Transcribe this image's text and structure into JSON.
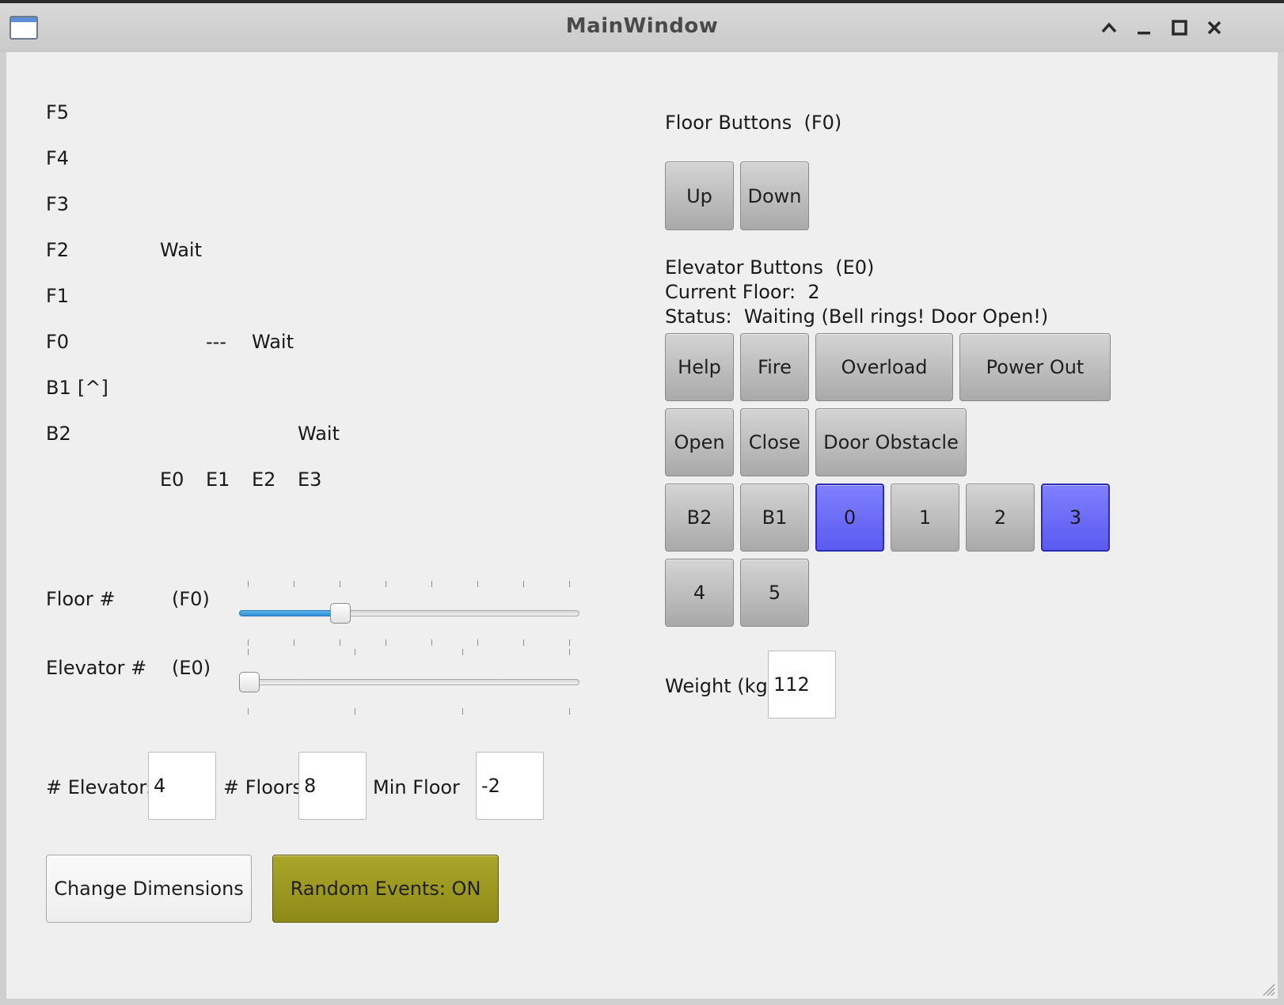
{
  "window": {
    "title": "MainWindow"
  },
  "floors": {
    "labels": [
      "F5",
      "F4",
      "F3",
      "F2",
      "F1",
      "F0",
      "B1",
      "B2"
    ],
    "b1_marker": "[^]",
    "cells": {
      "f2_e0": "Wait",
      "f0_e1": "---",
      "f0_e2": "Wait",
      "b2_e3": "Wait"
    },
    "elevators": [
      "E0",
      "E1",
      "E2",
      "E3"
    ]
  },
  "selectors": {
    "floor_label": "Floor #",
    "floor_value": "(F0)",
    "floor_level": 0.2857,
    "elevator_label": "Elevator #",
    "elevator_value": "(E0)",
    "elevator_level": 0.0
  },
  "dimensions": {
    "elevators_label": "# Elevators",
    "elevators_value": "4",
    "floors_label": "# Floors",
    "floors_value": "8",
    "min_floor_label": "Min Floor",
    "min_floor_value": "-2"
  },
  "actions": {
    "change_dimensions": "Change Dimensions",
    "random_events": "Random Events: ON"
  },
  "floor_panel": {
    "title": "Floor Buttons  (F0)",
    "up": "Up",
    "down": "Down"
  },
  "elevator_panel": {
    "title": "Elevator Buttons  (E0)",
    "current_floor": "Current Floor:  2",
    "status": "Status:  Waiting (Bell rings! Door Open!)",
    "help": "Help",
    "fire": "Fire",
    "overload": "Overload",
    "power_out": "Power Out",
    "open": "Open",
    "close": "Close",
    "door_obstacle": "Door Obstacle",
    "floor_buttons": [
      "B2",
      "B1",
      "0",
      "1",
      "2",
      "3",
      "4",
      "5"
    ],
    "lit_buttons": [
      "0",
      "3"
    ],
    "weight_label": "Weight (kg)",
    "weight_value": "112"
  },
  "colors": {
    "lit_button": "#6a6aff",
    "random_events_on": "#9c9820",
    "slider_fill": "#3b9be0"
  }
}
